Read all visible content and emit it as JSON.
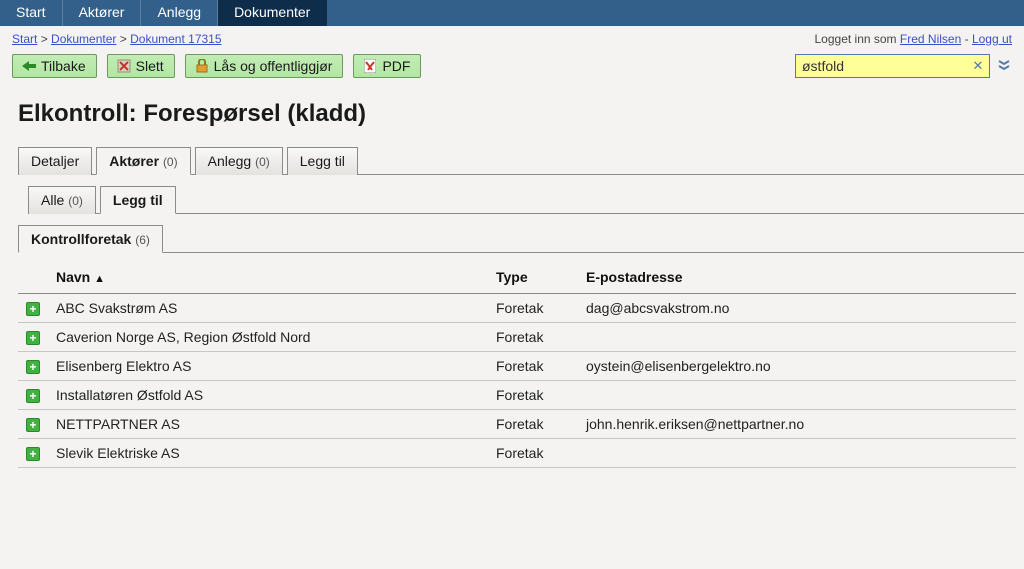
{
  "topnav": {
    "items": [
      {
        "label": "Start",
        "active": false
      },
      {
        "label": "Aktører",
        "active": false
      },
      {
        "label": "Anlegg",
        "active": false
      },
      {
        "label": "Dokumenter",
        "active": true
      }
    ]
  },
  "breadcrumb": {
    "items": [
      {
        "label": "Start"
      },
      {
        "label": "Dokumenter"
      },
      {
        "label": "Dokument 17315"
      }
    ],
    "sep": ">"
  },
  "user": {
    "prefix": "Logget inn som",
    "name": "Fred Nilsen",
    "sep": "-",
    "logout": "Logg ut"
  },
  "toolbar": {
    "back": "Tilbake",
    "delete": "Slett",
    "lock": "Lås og offentliggjør",
    "pdf": "PDF"
  },
  "search": {
    "value": "østfold"
  },
  "page_title": "Elkontroll: Forespørsel (kladd)",
  "tabs_main": [
    {
      "label": "Detaljer",
      "count": null,
      "active": false
    },
    {
      "label": "Aktører",
      "count": "(0)",
      "active": true
    },
    {
      "label": "Anlegg",
      "count": "(0)",
      "active": false
    },
    {
      "label": "Legg til",
      "count": null,
      "active": false
    }
  ],
  "tabs_sub": [
    {
      "label": "Alle",
      "count": "(0)",
      "active": false
    },
    {
      "label": "Legg til",
      "count": null,
      "active": true
    }
  ],
  "tabs_sub2": [
    {
      "label": "Kontrollforetak",
      "count": "(6)",
      "active": true
    }
  ],
  "grid": {
    "headers": {
      "name": "Navn",
      "type": "Type",
      "email": "E-postadresse"
    },
    "sort_indicator": "▲",
    "rows": [
      {
        "name": "ABC Svakstrøm AS",
        "type": "Foretak",
        "email": "dag@abcsvakstrom.no"
      },
      {
        "name": "Caverion Norge AS, Region Østfold Nord",
        "type": "Foretak",
        "email": ""
      },
      {
        "name": "Elisenberg Elektro AS",
        "type": "Foretak",
        "email": "oystein@elisenbergelektro.no"
      },
      {
        "name": "Installatøren Østfold AS",
        "type": "Foretak",
        "email": ""
      },
      {
        "name": "NETTPARTNER AS",
        "type": "Foretak",
        "email": "john.henrik.eriksen@nettpartner.no"
      },
      {
        "name": "Slevik Elektriske AS",
        "type": "Foretak",
        "email": ""
      }
    ]
  }
}
